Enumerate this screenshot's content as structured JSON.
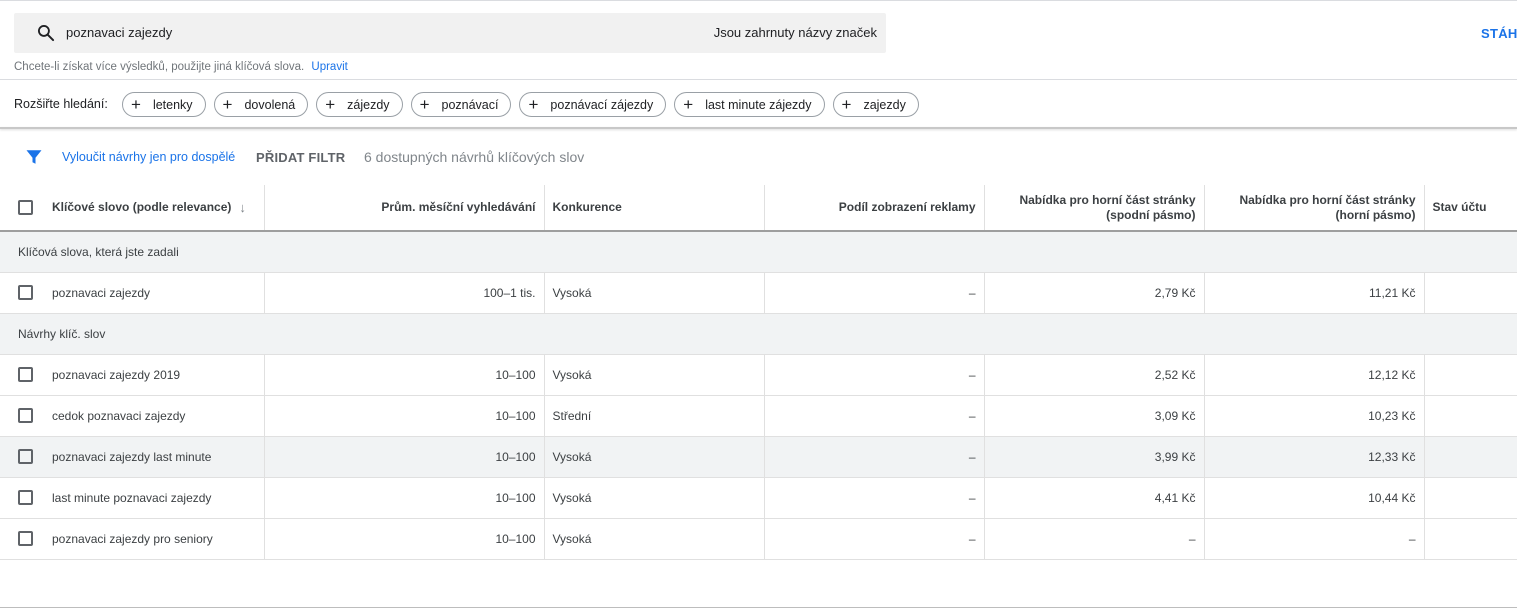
{
  "search": {
    "query": "poznavaci zajezdy",
    "brand_note": "Jsou zahrnuty názvy značek"
  },
  "download_label": "STÁH",
  "hint": {
    "text": "Chcete-li získat více výsledků, použijte jiná klíčová slova.",
    "link": "Upravit"
  },
  "expand": {
    "label": "Rozšiřte hledání:",
    "chips": [
      "letenky",
      "dovolená",
      "zájezdy",
      "poznávací",
      "poznávací zájezdy",
      "last minute zájezdy",
      "zajezdy"
    ]
  },
  "filters": {
    "adult": "Vyloučit návrhy jen pro dospělé",
    "add": "PŘIDAT FILTR",
    "available": "6 dostupných návrhů klíčových slov"
  },
  "table": {
    "headers": {
      "keyword": "Klíčové slovo (podle relevance)",
      "avg": "Prům. měsíční vyhledávání",
      "competition": "Konkurence",
      "impression": "Podíl zobrazení reklamy",
      "bid_low": "Nabídka pro horní část stránky (spodní pásmo)",
      "bid_high": "Nabídka pro horní část stránky (horní pásmo)",
      "status": "Stav účtu"
    },
    "group_entered": "Klíčová slova, která jste zadali",
    "group_ideas": "Návrhy klíč. slov",
    "entered_rows": [
      {
        "keyword": "poznavaci zajezdy",
        "avg": "100–1 tis.",
        "competition": "Vysoká",
        "impression": "–",
        "bid_low": "2,79 Kč",
        "bid_high": "11,21 Kč"
      }
    ],
    "idea_rows": [
      {
        "keyword": "poznavaci zajezdy 2019",
        "avg": "10–100",
        "competition": "Vysoká",
        "impression": "–",
        "bid_low": "2,52 Kč",
        "bid_high": "12,12 Kč"
      },
      {
        "keyword": "cedok poznavaci zajezdy",
        "avg": "10–100",
        "competition": "Střední",
        "impression": "–",
        "bid_low": "3,09 Kč",
        "bid_high": "10,23 Kč"
      },
      {
        "keyword": "poznavaci zajezdy last minute",
        "avg": "10–100",
        "competition": "Vysoká",
        "impression": "–",
        "bid_low": "3,99 Kč",
        "bid_high": "12,33 Kč"
      },
      {
        "keyword": "last minute poznavaci zajezdy",
        "avg": "10–100",
        "competition": "Vysoká",
        "impression": "–",
        "bid_low": "4,41 Kč",
        "bid_high": "10,44 Kč"
      },
      {
        "keyword": "poznavaci zajezdy pro seniory",
        "avg": "10–100",
        "competition": "Vysoká",
        "impression": "–",
        "bid_low": "–",
        "bid_high": "–"
      }
    ]
  },
  "colors": {
    "accent": "#1a73e8",
    "group_bg": "#f1f3f4",
    "search_bg": "#f1f1f1"
  },
  "icons": [
    "search-icon",
    "filter-icon",
    "plus-icon",
    "sort-down-icon"
  ]
}
